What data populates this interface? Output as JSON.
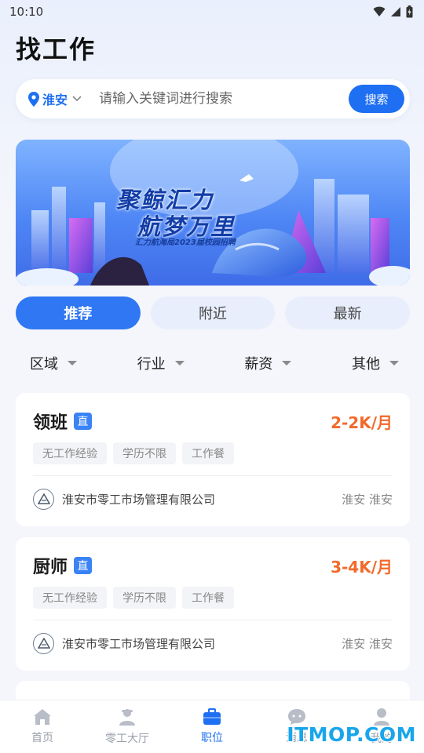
{
  "status_bar": {
    "time": "10:10"
  },
  "page": {
    "title": "找工作"
  },
  "search": {
    "location": "淮安",
    "placeholder": "请输入关键词进行搜索",
    "button_label": "搜索"
  },
  "banner": {
    "title_line1": "聚鲸汇力",
    "title_line2": "航梦万里",
    "subtitle": "汇力航海局2023届校园招聘"
  },
  "tabs": [
    {
      "label": "推荐",
      "active": true
    },
    {
      "label": "附近",
      "active": false
    },
    {
      "label": "最新",
      "active": false
    }
  ],
  "filters": [
    {
      "label": "区域"
    },
    {
      "label": "行业"
    },
    {
      "label": "薪资"
    },
    {
      "label": "其他"
    }
  ],
  "jobs": [
    {
      "title": "领班",
      "badge": "直",
      "salary": "2-2K/月",
      "tags": [
        "无工作经验",
        "学历不限",
        "工作餐"
      ],
      "company": "淮安市零工市场管理有限公司",
      "location": "淮安 淮安"
    },
    {
      "title": "厨师",
      "badge": "直",
      "salary": "3-4K/月",
      "tags": [
        "无工作经验",
        "学历不限",
        "工作餐"
      ],
      "company": "淮安市零工市场管理有限公司",
      "location": "淮安 淮安"
    }
  ],
  "bottom_nav": [
    {
      "label": "首页",
      "icon": "home-icon",
      "active": false
    },
    {
      "label": "零工大厅",
      "icon": "worker-icon",
      "active": false
    },
    {
      "label": "职位",
      "icon": "briefcase-icon",
      "active": true
    },
    {
      "label": "消息",
      "icon": "message-icon",
      "active": false
    },
    {
      "label": "我的",
      "icon": "user-icon",
      "active": false
    }
  ],
  "watermark": "ITMOP.COM",
  "colors": {
    "primary": "#1f6ff2",
    "salary": "#f26a2a",
    "background": "#f4f6fb"
  }
}
